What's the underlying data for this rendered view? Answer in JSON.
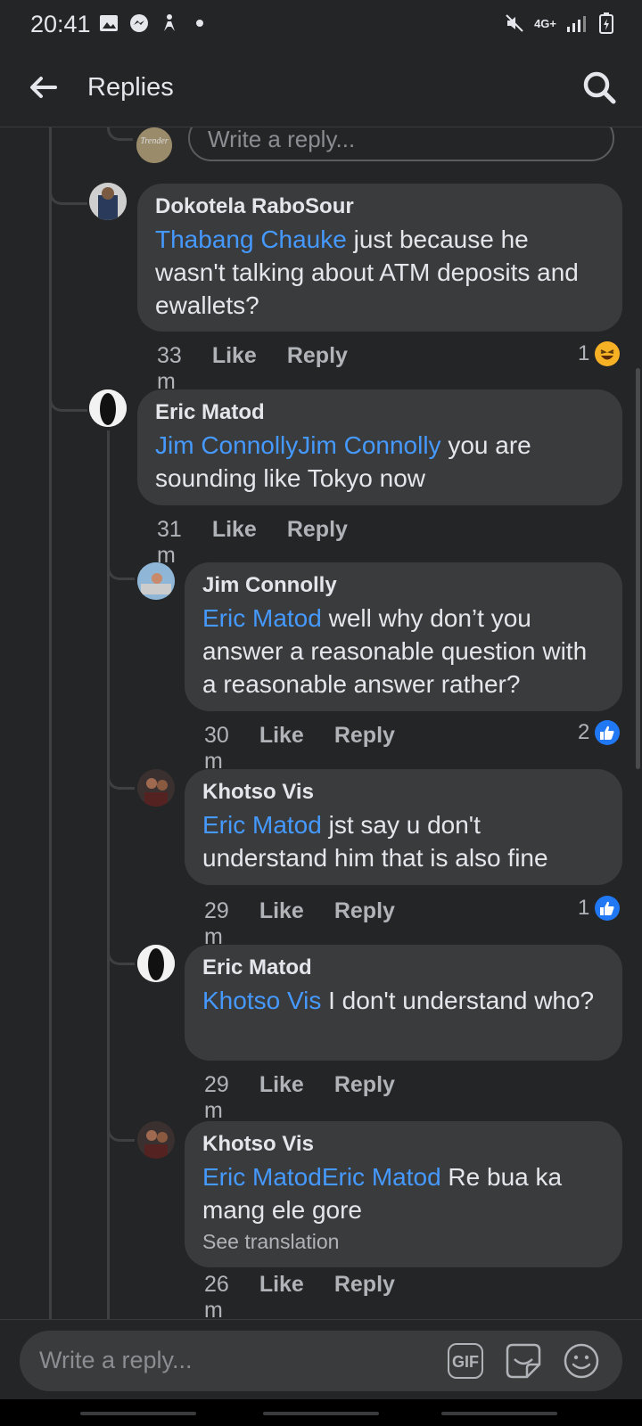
{
  "status_bar": {
    "time": "20:41",
    "network": "4G+"
  },
  "header": {
    "title": "Replies"
  },
  "top_reply": {
    "placeholder": "Write a reply...",
    "avatar_text": "Trender"
  },
  "comments": [
    {
      "author": "Dokotela RaboSour",
      "mention": "Thabang Chauke",
      "text": " just because he wasn't talking about ATM deposits and ewallets?",
      "time": "33 m",
      "like": "Like",
      "reply": "Reply",
      "reaction_count": "1",
      "reaction": "haha"
    },
    {
      "author": "Eric Matod",
      "mention": "Jim ConnollyJim Connolly",
      "text": " you are sounding like Tokyo now",
      "time": "31 m",
      "like": "Like",
      "reply": "Reply"
    },
    {
      "author": "Jim Connolly",
      "mention": "Eric Matod",
      "text": " well why don’t you answer a reasonable question with a reasonable answer rather?",
      "time": "30 m",
      "like": "Like",
      "reply": "Reply",
      "reaction_count": "2",
      "reaction": "like"
    },
    {
      "author": "Khotso Vis",
      "mention": "Eric Matod",
      "text": " jst say u don't understand him that is also fine",
      "time": "29 m",
      "like": "Like",
      "reply": "Reply",
      "reaction_count": "1",
      "reaction": "like"
    },
    {
      "author": "Eric Matod",
      "mention": "Khotso Vis",
      "text": " I don't understand who?",
      "time": "29 m",
      "like": "Like",
      "reply": "Reply"
    },
    {
      "author": "Khotso Vis",
      "mention": "Eric MatodEric Matod",
      "text": " Re bua ka mang ele gore",
      "see_translation": "See translation",
      "time": "26 m",
      "like": "Like",
      "reply": "Reply"
    }
  ],
  "composer": {
    "placeholder": "Write a reply...",
    "gif_label": "GIF"
  },
  "colors": {
    "background": "#242526",
    "bubble": "#3a3b3c",
    "mention": "#4599ff",
    "like": "#2078f4"
  }
}
